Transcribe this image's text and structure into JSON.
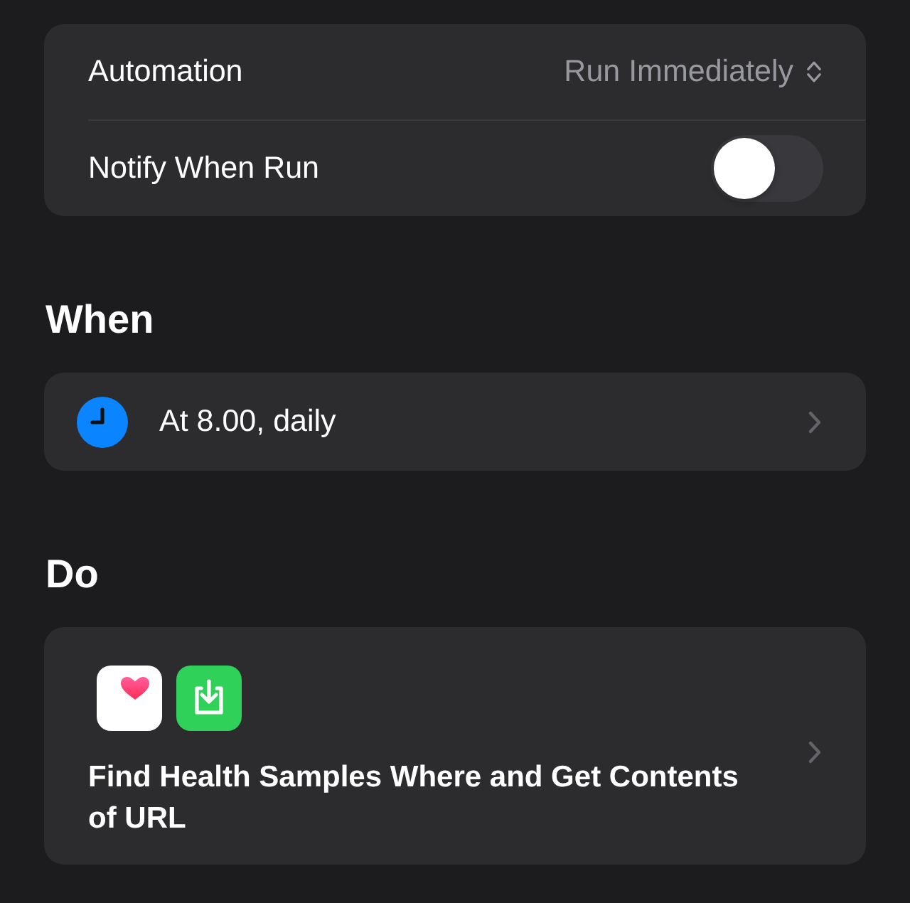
{
  "settings": {
    "rows": [
      {
        "kind": "picker",
        "label": "Automation",
        "value": "Run Immediately"
      },
      {
        "kind": "toggle",
        "label": "Notify When Run",
        "on": false
      }
    ]
  },
  "when": {
    "heading": "When",
    "trigger": {
      "text": "At 8.00, daily"
    }
  },
  "do": {
    "heading": "Do",
    "action": {
      "apps": [
        {
          "kind": "health"
        },
        {
          "kind": "download"
        }
      ],
      "text": "Find Health Samples Where and Get Contents of URL"
    }
  }
}
